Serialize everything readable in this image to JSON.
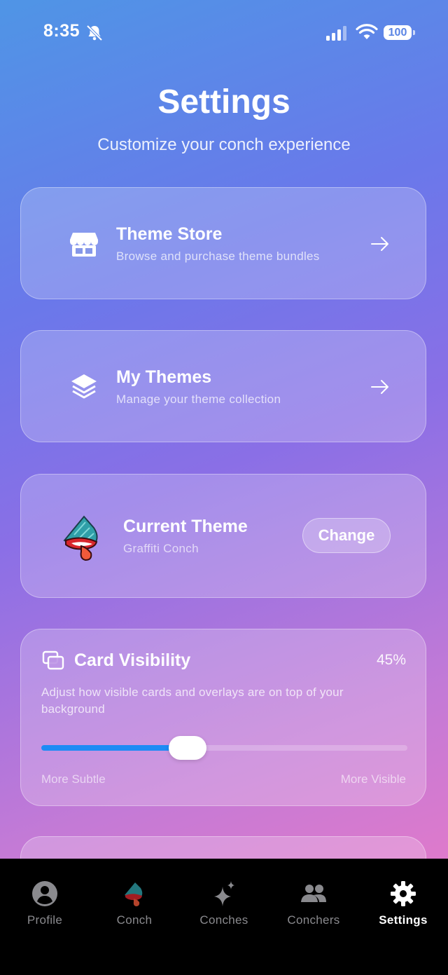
{
  "status": {
    "time": "8:35",
    "battery": "100"
  },
  "header": {
    "title": "Settings",
    "subtitle": "Customize your conch experience"
  },
  "cards": [
    {
      "title": "Theme Store",
      "subtitle": "Browse and purchase theme bundles",
      "icon": "storefront-icon"
    },
    {
      "title": "My Themes",
      "subtitle": "Manage your theme collection",
      "icon": "layers-icon"
    }
  ],
  "current_theme": {
    "title": "Current Theme",
    "name": "Graffiti Conch",
    "button": "Change"
  },
  "card_visibility": {
    "title": "Card Visibility",
    "percent_label": "45%",
    "value": 0.4,
    "description": "Adjust how visible cards and overlays are on top of your background",
    "min_label": "More Subtle",
    "max_label": "More Visible"
  },
  "tabs": [
    {
      "label": "Profile",
      "icon": "person-icon",
      "active": false
    },
    {
      "label": "Conch",
      "icon": "conch-icon",
      "active": false
    },
    {
      "label": "Conches",
      "icon": "sparkles-icon",
      "active": false
    },
    {
      "label": "Conchers",
      "icon": "people-icon",
      "active": false
    },
    {
      "label": "Settings",
      "icon": "gear-icon",
      "active": true
    }
  ],
  "colors": {
    "accent": "#1e8bf5",
    "tab_inactive": "#8a8a8e",
    "tab_bar": "#000000"
  }
}
